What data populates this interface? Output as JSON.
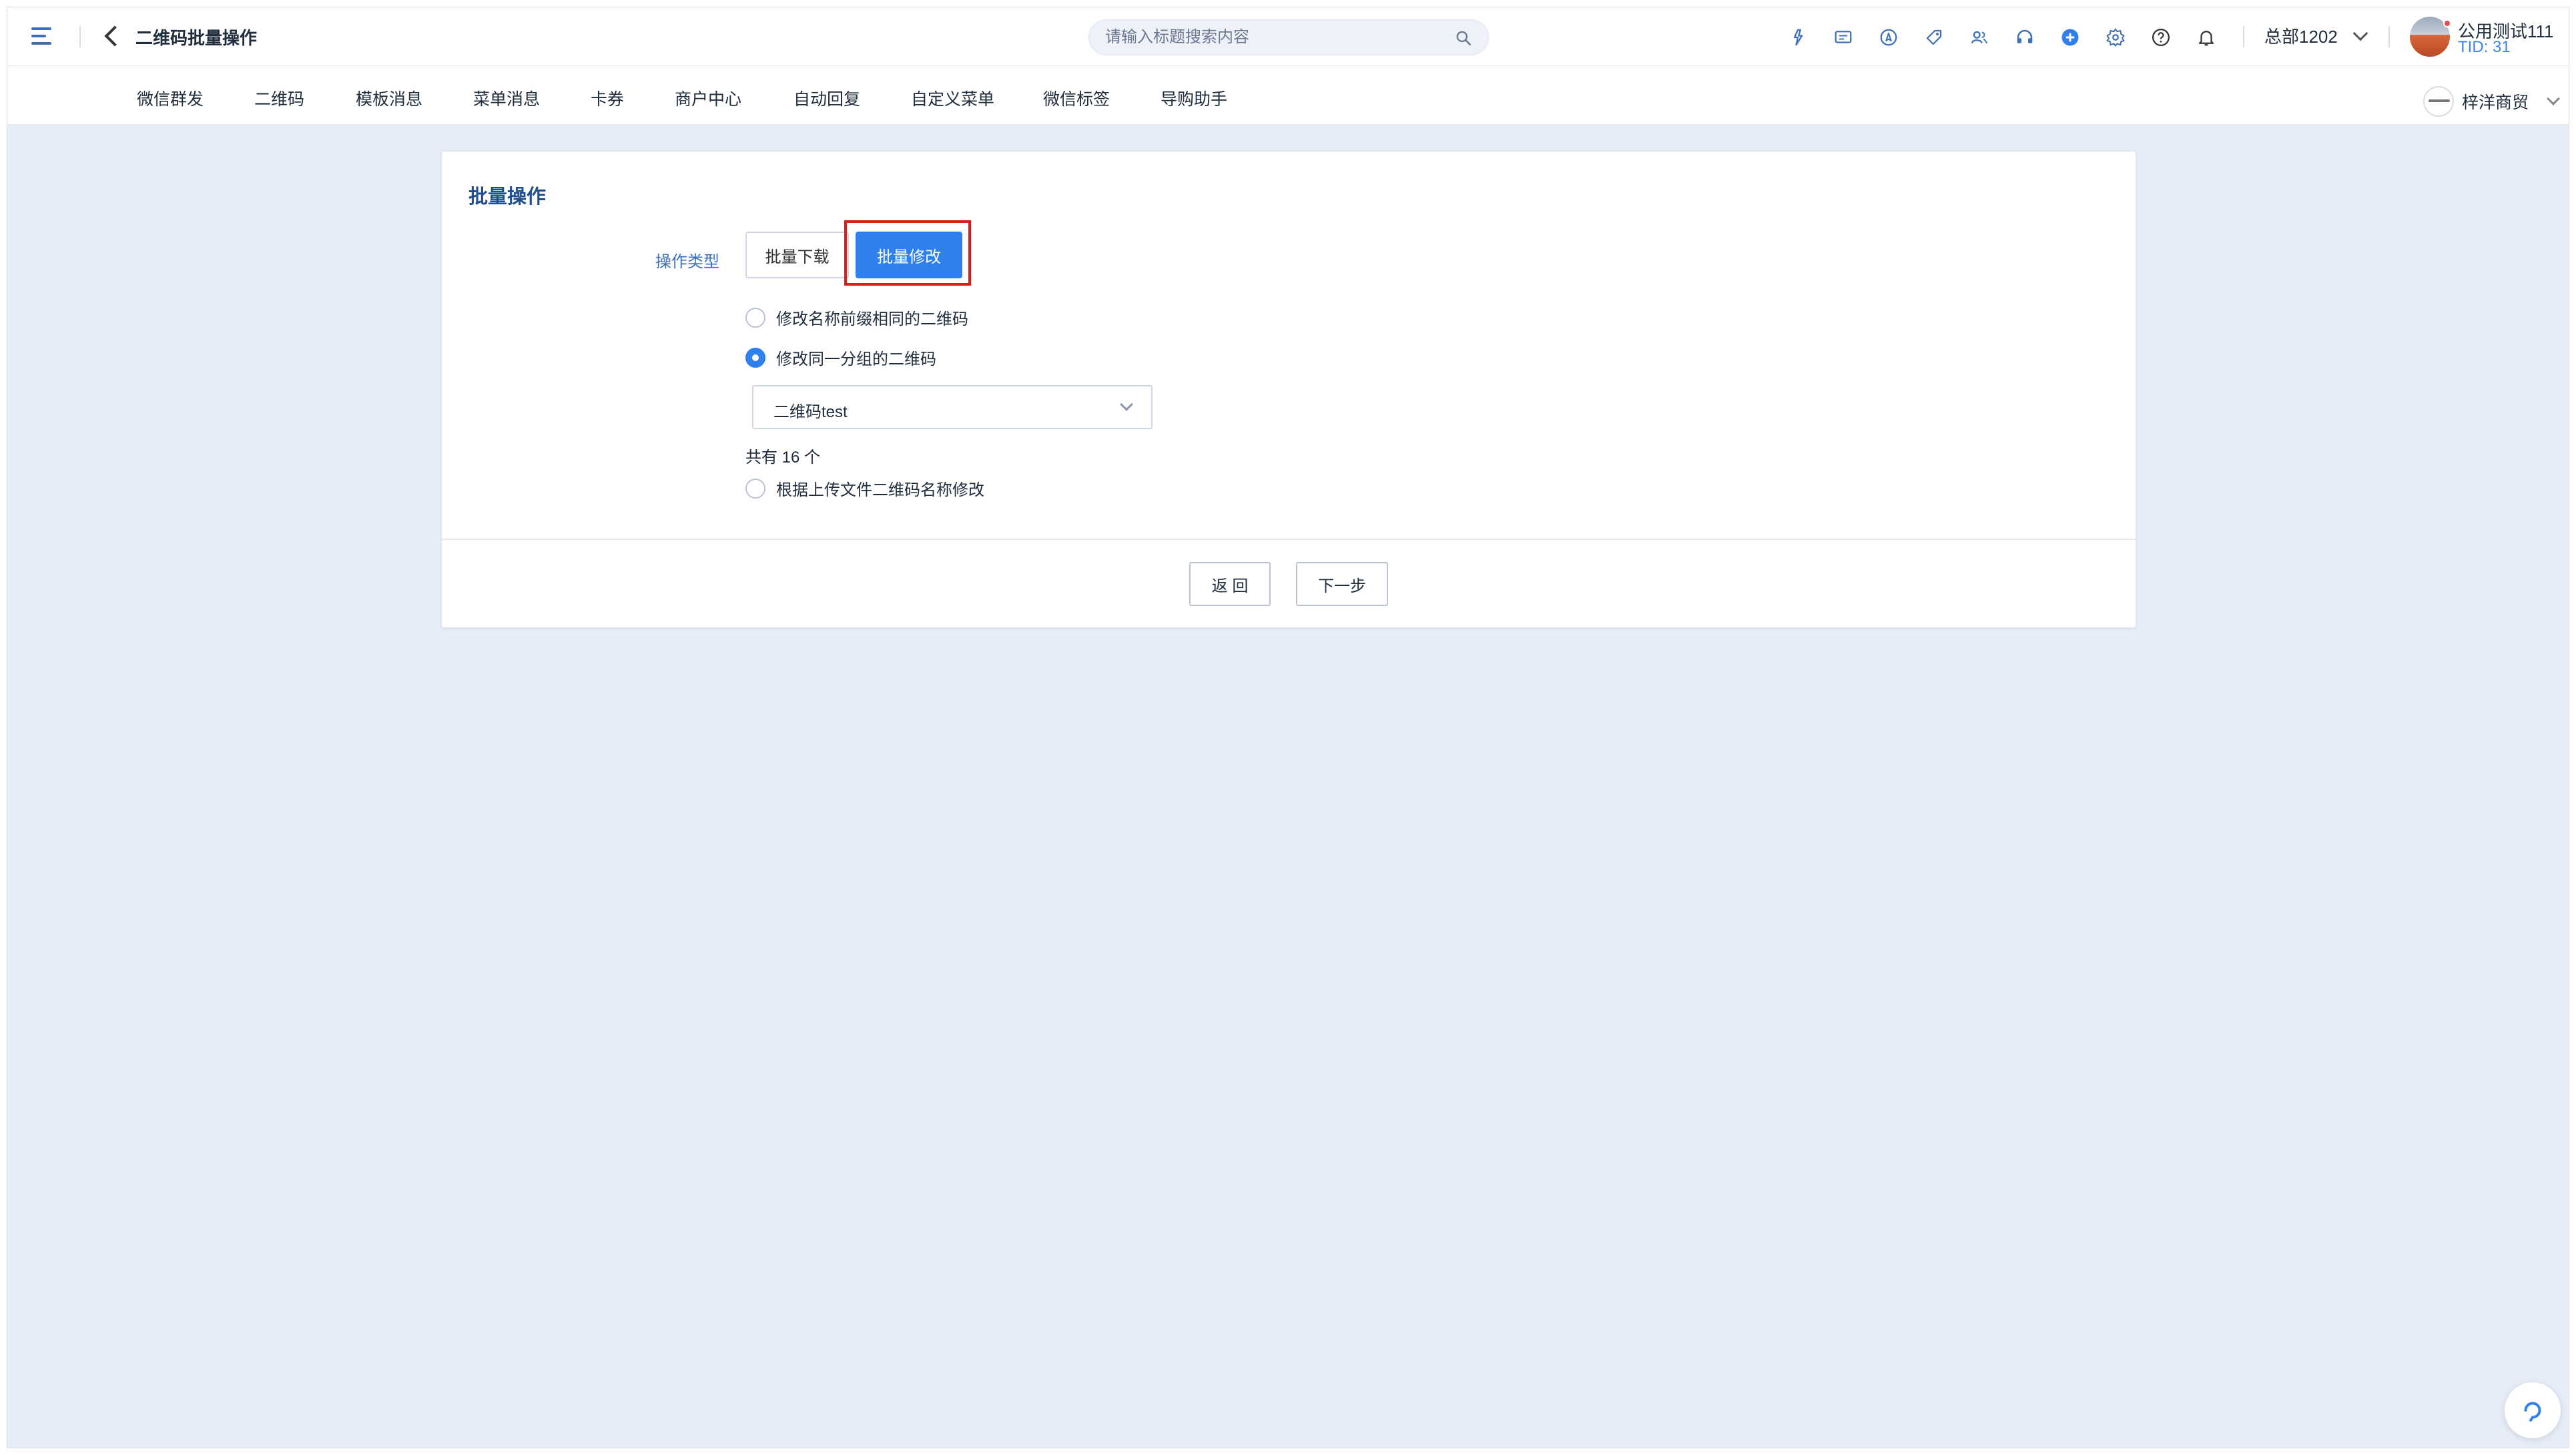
{
  "header": {
    "page_title": "二维码批量操作",
    "search_placeholder": "请输入标题搜索内容",
    "org_name": "总部1202",
    "user_name": "公用测试111",
    "user_tid": "TID: 31",
    "icons": [
      "flash-icon",
      "message-icon",
      "compass-icon",
      "tag-icon",
      "users-icon",
      "headset-icon",
      "plus-circle-icon",
      "settings-icon",
      "help-icon",
      "bell-icon"
    ],
    "accent_color": "#2f80ed"
  },
  "nav": {
    "items": [
      "微信群发",
      "二维码",
      "模板消息",
      "菜单消息",
      "卡券",
      "商户中心",
      "自动回复",
      "自定义菜单",
      "微信标签",
      "导购助手"
    ],
    "merchant_name": "梓洋商贸"
  },
  "card": {
    "title": "批量操作",
    "operation_type_label": "操作类型",
    "btn_download": "批量下载",
    "btn_modify": "批量修改",
    "options": [
      {
        "label": "修改名称前缀相同的二维码",
        "checked": false
      },
      {
        "label": "修改同一分组的二维码",
        "checked": true
      },
      {
        "label": "根据上传文件二维码名称修改",
        "checked": false
      }
    ],
    "group_select_value": "二维码test",
    "count_text": "共有 16 个",
    "btn_back": "返 回",
    "btn_next": "下一步"
  }
}
